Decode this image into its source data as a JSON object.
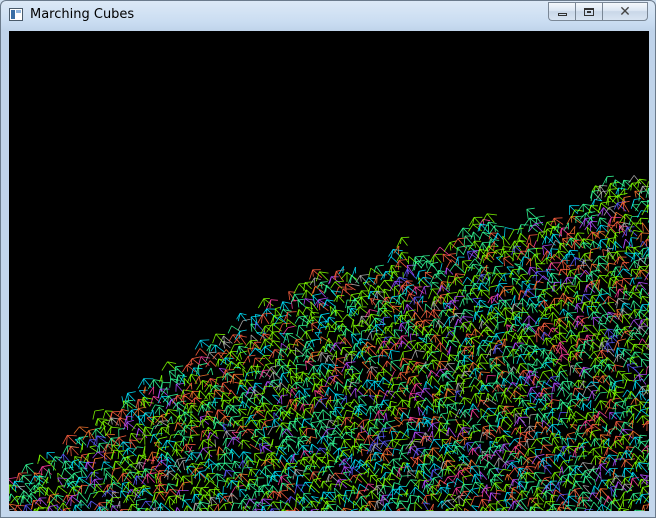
{
  "window": {
    "title": "Marching Cubes",
    "buttons": {
      "minimize_icon": "minimize-icon",
      "maximize_icon": "maximize-icon",
      "close_icon": "close-icon",
      "close_glyph": "✕"
    }
  },
  "viewport": {
    "background": "#000000",
    "render_mode": "wireframe",
    "palette": [
      "#7fff00",
      "#33ff99",
      "#00e5ff",
      "#ff6040",
      "#ff7a30",
      "#b24dff",
      "#5a5aff",
      "#b0b0b0",
      "#ff3fa0"
    ]
  }
}
